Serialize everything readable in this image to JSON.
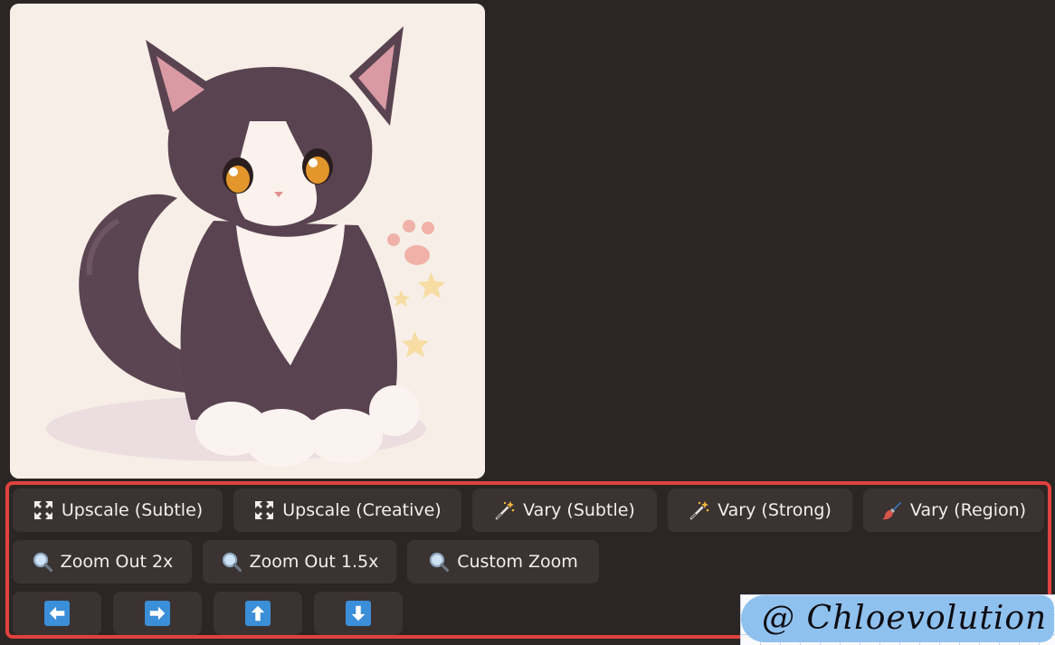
{
  "image": {
    "subject": "kitten-illustration"
  },
  "actions": {
    "row1": [
      {
        "label": "Upscale (Subtle)",
        "icon": "upscale-icon"
      },
      {
        "label": "Upscale (Creative)",
        "icon": "upscale-icon"
      },
      {
        "label": "Vary (Subtle)",
        "icon": "magic-wand-icon"
      },
      {
        "label": "Vary (Strong)",
        "icon": "magic-wand-icon"
      },
      {
        "label": "Vary (Region)",
        "icon": "paintbrush-icon"
      }
    ],
    "row2": [
      {
        "label": "Zoom Out 2x",
        "icon": "magnifier-icon"
      },
      {
        "label": "Zoom Out 1.5x",
        "icon": "magnifier-icon"
      },
      {
        "label": "Custom Zoom",
        "icon": "magnifier-icon"
      }
    ],
    "row3": [
      {
        "icon": "arrow-left-icon"
      },
      {
        "icon": "arrow-right-icon"
      },
      {
        "icon": "arrow-up-icon"
      },
      {
        "icon": "arrow-down-icon"
      }
    ]
  },
  "watermark": {
    "text": "@ Chloevolution"
  },
  "colors": {
    "background": "#2b2523",
    "button": "#3a3331",
    "highlight_border": "#e0423e",
    "arrow_accent": "#3b8ed8",
    "watermark_pill": "#8fc1ee"
  }
}
